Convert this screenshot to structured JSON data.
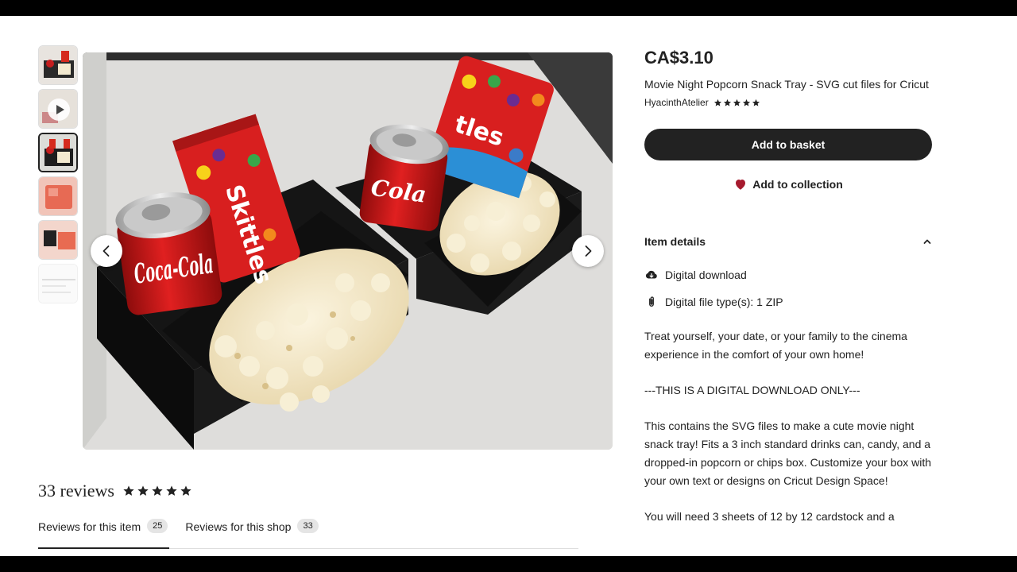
{
  "listing": {
    "price": "CA$3.10",
    "title": "Movie Night Popcorn Snack Tray - SVG cut files for Cricut",
    "shop_name": "HyacinthAtelier",
    "rating_stars": 5
  },
  "actions": {
    "add_to_basket": "Add to basket",
    "add_to_collection": "Add to collection"
  },
  "item_details": {
    "heading": "Item details",
    "rows": [
      {
        "icon": "cloud-download-icon",
        "label": "Digital download"
      },
      {
        "icon": "paperclip-icon",
        "label": "Digital file type(s): 1 ZIP"
      }
    ]
  },
  "description": {
    "p1": "Treat yourself, your date, or your family to the cinema experience in the comfort of your own home!",
    "p2": "---THIS IS A DIGITAL DOWNLOAD ONLY---",
    "p3": "This contains the SVG files to make a cute movie night snack tray! Fits a 3 inch standard drinks can, candy, and a dropped-in popcorn or chips box. Customize your box with your own text or designs on Cricut Design Space!",
    "p4": "You will need 3 sheets of 12 by 12 cardstock and a"
  },
  "reviews": {
    "count_label": "33 reviews",
    "stars": 5,
    "tabs": [
      {
        "label": "Reviews for this item",
        "count": "25"
      },
      {
        "label": "Reviews for this shop",
        "count": "33"
      }
    ]
  },
  "image_labels": {
    "can_brand": "Coca-Cola",
    "candy_brand": "Skittles"
  },
  "colors": {
    "primary_button": "#222222",
    "heart": "#a61a2e",
    "star": "#222222"
  }
}
